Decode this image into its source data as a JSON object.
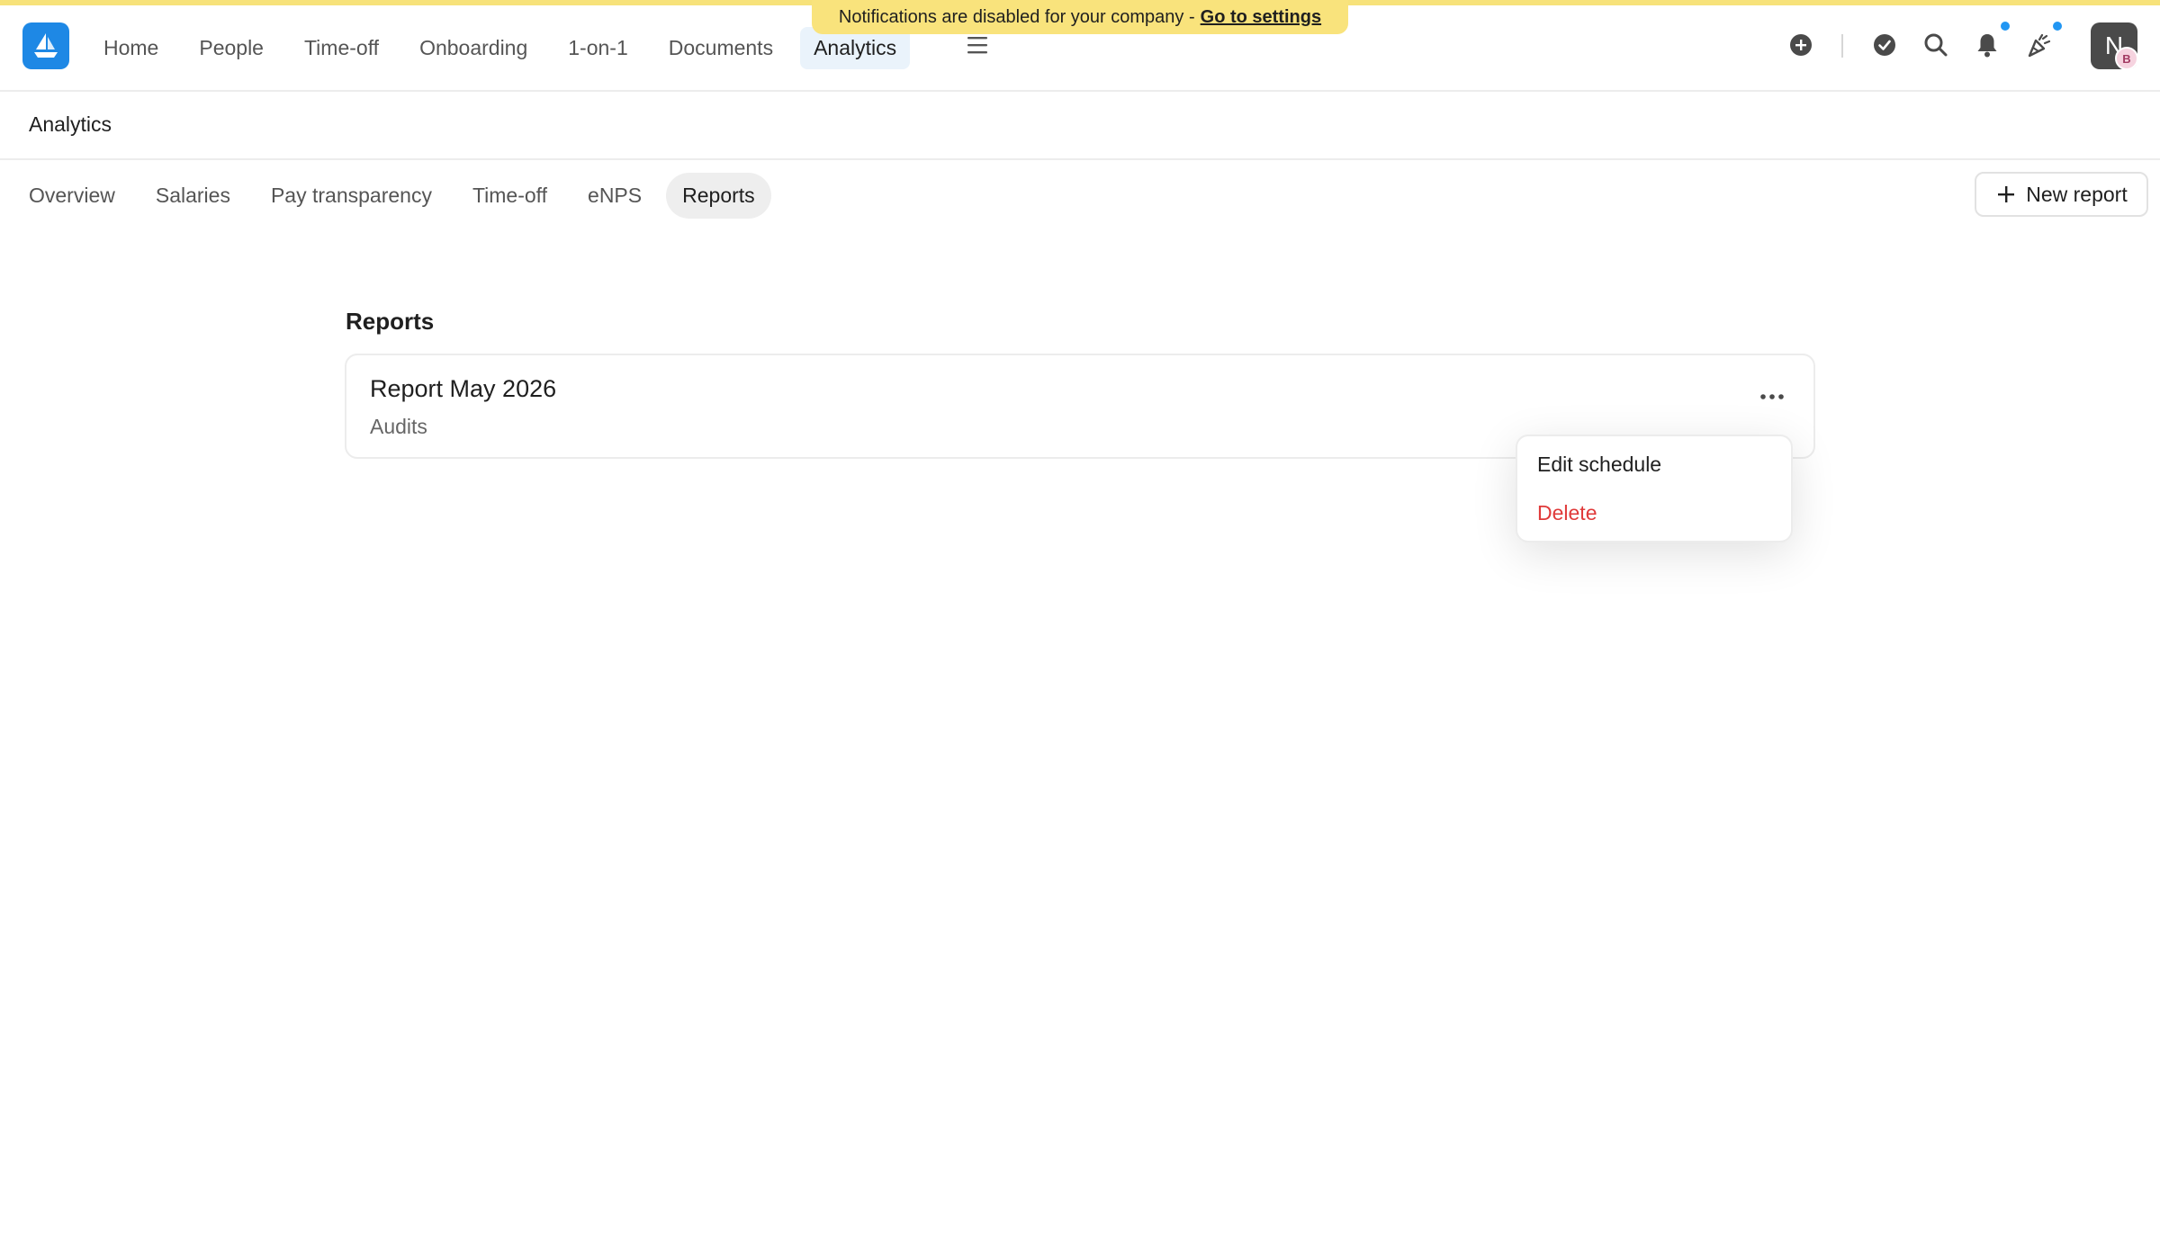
{
  "banner": {
    "message": "Notifications are disabled for your company -",
    "link": "Go to settings"
  },
  "nav": {
    "items": [
      {
        "label": "Home"
      },
      {
        "label": "People"
      },
      {
        "label": "Time-off"
      },
      {
        "label": "Onboarding"
      },
      {
        "label": "1-on-1"
      },
      {
        "label": "Documents"
      },
      {
        "label": "Analytics",
        "active": true
      }
    ]
  },
  "user": {
    "initial": "N",
    "badge": "B"
  },
  "section": {
    "title": "Analytics"
  },
  "subtabs": [
    {
      "label": "Overview"
    },
    {
      "label": "Salaries"
    },
    {
      "label": "Pay transparency"
    },
    {
      "label": "Time-off"
    },
    {
      "label": "eNPS"
    },
    {
      "label": "Reports",
      "active": true
    }
  ],
  "toolbar": {
    "new_report_label": "New report"
  },
  "reports": {
    "heading": "Reports",
    "items": [
      {
        "name": "Report May 2026",
        "type": "Audits"
      }
    ]
  },
  "menu": {
    "edit_schedule": "Edit schedule",
    "delete": "Delete"
  },
  "colors": {
    "banner": "#f9e37c",
    "accent": "#1e88e5",
    "danger": "#e03a3a",
    "active_nav_bg": "#eaf3fb",
    "notification_dot": "#2196f3"
  }
}
